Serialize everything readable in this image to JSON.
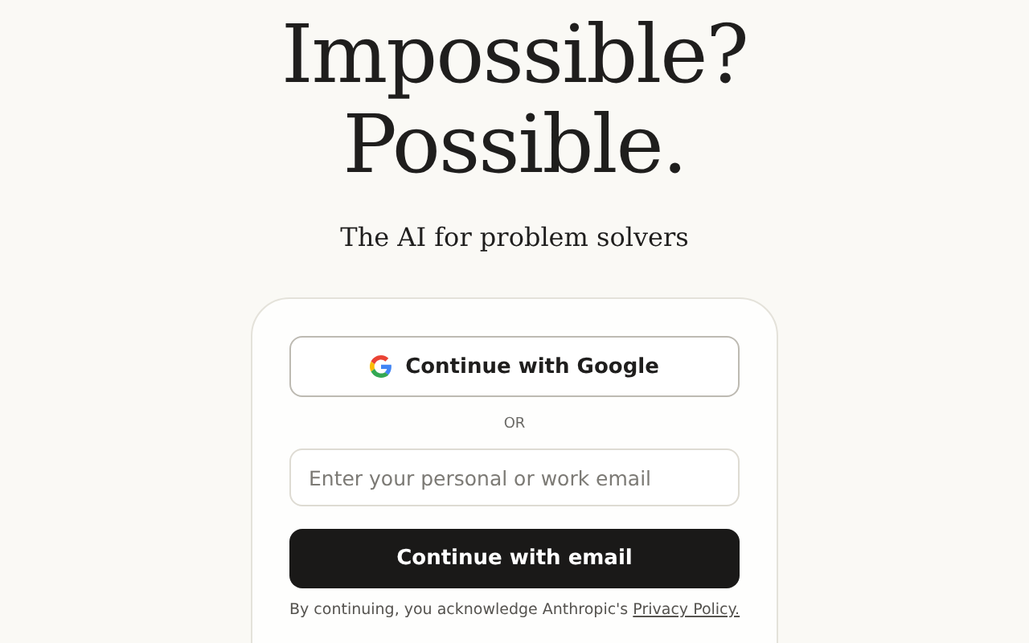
{
  "headline": [
    "Impossible?",
    "Possible."
  ],
  "tagline": "The AI for problem solvers",
  "login": {
    "google_button": "Continue with Google",
    "divider": "OR",
    "email": {
      "placeholder": "Enter your personal or work email"
    },
    "email_button": "Continue with email",
    "legal": {
      "text": "By continuing, you acknowledge Anthropic's",
      "link": "Privacy Policy."
    }
  }
}
